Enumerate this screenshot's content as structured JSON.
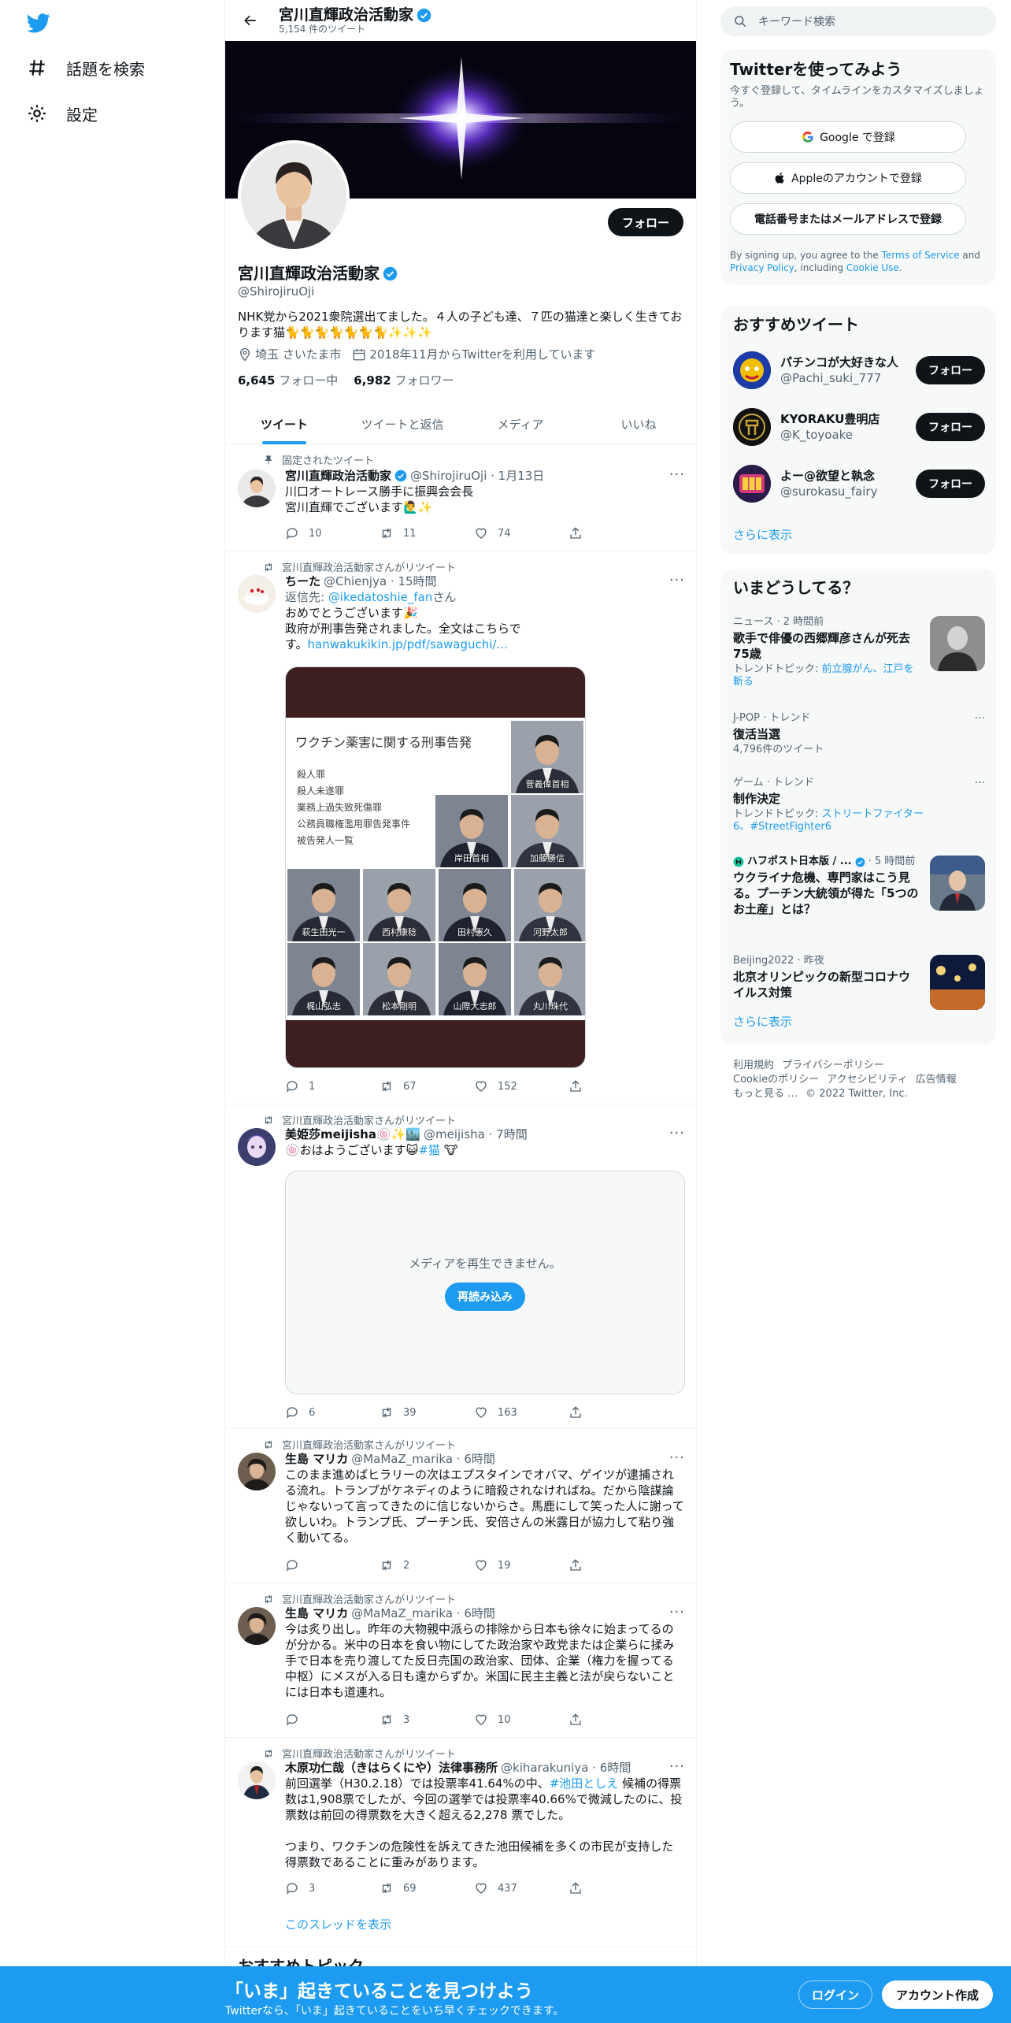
{
  "nav": {
    "explore_label": "話題を検索",
    "settings_label": "設定"
  },
  "header": {
    "name": "宮川直輝政治活動家",
    "tweet_count": "5,154 件のツイート"
  },
  "profile": {
    "name": "宮川直輝政治活動家",
    "handle": "@ShirojiruOji",
    "follow_label": "フォロー",
    "bio": "NHK党から2021衆院選出てました。４人の子ども達、７匹の猫達と楽しく生きております猫🐈🐈🐈🐈🐈🐈🐈✨✨✨",
    "location": "埼玉 さいたま市",
    "joined": "2018年11月からTwitterを利用しています",
    "following_count": "6,645",
    "following_label": "フォロー中",
    "followers_count": "6,982",
    "followers_label": "フォロワー"
  },
  "tabs": [
    "ツイート",
    "ツイートと返信",
    "メディア",
    "いいね"
  ],
  "tweets": [
    {
      "context": "固定されたツイート",
      "name": "宮川直輝政治活動家",
      "meta": "@ShirojiruOji · 1月13日",
      "text1": "川口オートレース勝手に振興会会長",
      "text2": "宮川直輝でございます🙋‍♂️✨",
      "replies": "10",
      "retweets": "11",
      "likes": "74"
    },
    {
      "context": "宮川直輝政治活動家さんがリツイート",
      "name": "ちーた",
      "meta": "@Chienjya · 15時間",
      "reply_prefix": "返信先: ",
      "reply_to": "@ikedatoshie_fan",
      "reply_suffix": "さん",
      "text1": "おめでとうございます🎉",
      "text2": "政府が刑事告発されました。全文はこちらで",
      "text3": "す。",
      "link": "hanwakukikin.jp/pdf/sawaguchi/...",
      "image_title": "ワクチン薬害に関する刑事告発",
      "image_list": [
        "殺人罪",
        "殺人未遂罪",
        "業務上過失致死傷罪",
        "公務員職権濫用罪告発事件",
        "被告発人一覧"
      ],
      "image_names": [
        "菅義偉首相",
        "岸田首相",
        "加藤勝信",
        "萩生田光一",
        "西村康稔",
        "田村憲久",
        "河野太郎",
        "梶山弘志",
        "松本剛明",
        "山際大志郎",
        "丸川珠代"
      ],
      "replies": "1",
      "retweets": "67",
      "likes": "152"
    },
    {
      "context": "宮川直輝政治活動家さんがリツイート",
      "name": "美姫莎meijisha🍥✨🏙️",
      "meta": "@meijisha · 7時間",
      "text1": "🍥おはようございます😺",
      "hashtag": "#猫",
      "emoji": "🐮",
      "media_error": "メディアを再生できません。",
      "reload": "再読み込み",
      "replies": "6",
      "retweets": "39",
      "likes": "163"
    },
    {
      "context": "宮川直輝政治活動家さんがリツイート",
      "name": "生島 マリカ",
      "meta": "@MaMaZ_marika · 6時間",
      "text1": "このまま進めばヒラリーの次はエプスタインでオバマ、ゲイツが逮捕される流れ。トランプがケネディのように暗殺されなければね。だから陰謀論じゃないって言ってきたのに信じないからさ。馬鹿にして笑った人に謝って欲しいわ。トランプ氏、プーチン氏、安倍さんの米露日が協力して粘り強く動いてる。",
      "replies": "",
      "retweets": "2",
      "likes": "19"
    },
    {
      "context": "宮川直輝政治活動家さんがリツイート",
      "name": "生島 マリカ",
      "meta": "@MaMaZ_marika · 6時間",
      "text1": "今は炙り出し。昨年の大物親中派らの排除から日本も徐々に始まってるのが分かる。米中の日本を食い物にしてた政治家や政党または企業らに揉み手で日本を売り渡してた反日売国の政治家、団体、企業（権力を握ってる中枢）にメスが入る日も遠からずか。米国に民主主義と法が戻らないことには日本も道連れ。",
      "replies": "",
      "retweets": "3",
      "likes": "10"
    },
    {
      "context": "宮川直輝政治活動家さんがリツイート",
      "name": "木原功仁哉（きはらくにや）法律事務所",
      "meta": "@kiharakuniya · 6時間",
      "text1a": "前回選挙（H30.2.18）では投票率41.64%の中、",
      "text1link": "#池田としえ",
      "text1b": " 候補の得票数は1,908票でしたが、今回の選挙では投票率40.66%で微減したのに、投票数は前回の得票数を大きく超える2,278 票でした。",
      "text2": "つまり、ワクチンの危険性を訴えてきた池田候補を多くの市民が支持した得票数であることに重みがあります。",
      "thread_link": "このスレッドを表示",
      "replies": "3",
      "retweets": "69",
      "likes": "437"
    }
  ],
  "next_section": "おすすめトピック",
  "right": {
    "search_placeholder": "キーワード検索",
    "signup_title": "Twitterを使ってみよう",
    "signup_sub": "今すぐ登録して、タイムラインをカスタマイズしましょう。",
    "google": "Google で登録",
    "apple": "Appleのアカウントで登録",
    "phone": "電話番号またはメールアドレスで登録",
    "legal_a": "By signing up, you agree to the ",
    "legal_terms": "Terms of Service",
    "legal_b": " and ",
    "legal_privacy": "Privacy Policy",
    "legal_c": ", including ",
    "legal_cookie": "Cookie Use",
    "legal_d": ".",
    "rec_title": "おすすめツイート",
    "recs": [
      {
        "name": "パチンコが大好きな人",
        "handle": "@Pachi_suki_777",
        "btn": "フォロー"
      },
      {
        "name": "KYORAKU豊明店",
        "handle": "@K_toyoake",
        "btn": "フォロー"
      },
      {
        "name": "よー@欲望と執念",
        "handle": "@surokasu_fairy",
        "btn": "フォロー"
      }
    ],
    "show_more": "さらに表示",
    "trends_title": "いまどうしてる？",
    "trends": [
      {
        "cat": "ニュース · 2 時間前",
        "title": "歌手で俳優の西郷輝彦さんが死去 75歳",
        "desc_a": "トレンドトピック: ",
        "desc_link": "前立腺がん、江戸を斬る"
      },
      {
        "cat": "J-POP · トレンド",
        "title": "復活当選",
        "desc": "4,796件のツイート"
      },
      {
        "cat": "ゲーム · トレンド",
        "title": "制作決定",
        "desc_a": "トレンドトピック: ",
        "desc_link": "ストリートファイター6、#StreetFighter6"
      },
      {
        "cat_a": "ハフポスト日本版 / ...",
        "cat_b": " · 5 時間前",
        "title": "ウクライナ危機、専門家はこう見る。プーチン大統領が得た「5つのお土産」とは？"
      },
      {
        "cat": "Beijing2022 · 昨夜",
        "title": "北京オリンピックの新型コロナウイルス対策"
      }
    ],
    "footer": [
      "利用規約",
      "プライバシーポリシー",
      "Cookieのポリシー",
      "アクセシビリティ",
      "広告情報",
      "もっと見る …",
      "© 2022 Twitter, Inc."
    ]
  },
  "bottom": {
    "headline": "「いま」起きていることを見つけよう",
    "sub": "Twitterなら、「いま」起きていることをいち早くチェックできます。",
    "login": "ログイン",
    "signup": "アカウント作成"
  },
  "colors": {
    "accent": "#1d9bf0",
    "text": "#0f1419",
    "secondary": "#536471",
    "panel": "#f7f9f9"
  }
}
